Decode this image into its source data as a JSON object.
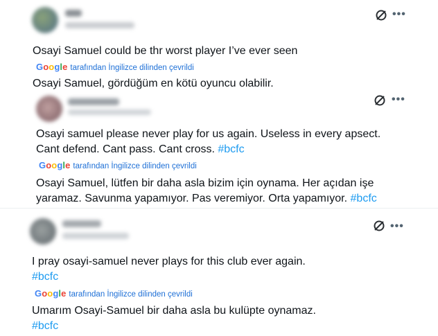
{
  "colors": {
    "text": "#0f1419",
    "hashtag": "#1d9bf0",
    "translate_link": "#1d6fd6",
    "icon": "#536471",
    "divider": "#eceff1"
  },
  "google_logo": {
    "G": "G",
    "o1": "o",
    "o2": "o",
    "g": "g",
    "l": "l",
    "e": "e"
  },
  "translate_label": "tarafından İngilizce dilinden çevrildi",
  "more_icon": "•••",
  "tweets": [
    {
      "original": "Osayi Samuel could be thr worst player I’ve ever seen",
      "translation": "Osayi Samuel, gördüğüm en kötü oyuncu olabilir."
    },
    {
      "original_line1": "Osayi samuel please never play for us again. Useless in every apsect.",
      "original_line2": "Cant defend. Cant pass. Cant cross. ",
      "original_hashtag": "#bcfc",
      "translation_line1": "Osayi Samuel, lütfen bir daha asla bizim için oynama. Her açıdan işe",
      "translation_line2": "yaramaz. Savunma yapamıyor. Pas veremiyor. Orta yapamıyor. ",
      "translation_hashtag": "#bcfc"
    },
    {
      "original": "I pray osayi-samuel never plays for this club ever again.",
      "original_hashtag": "#bcfc",
      "translation": "Umarım Osayi-Samuel bir daha asla bu kulüpte oynamaz.",
      "translation_hashtag": "#bcfc"
    }
  ]
}
